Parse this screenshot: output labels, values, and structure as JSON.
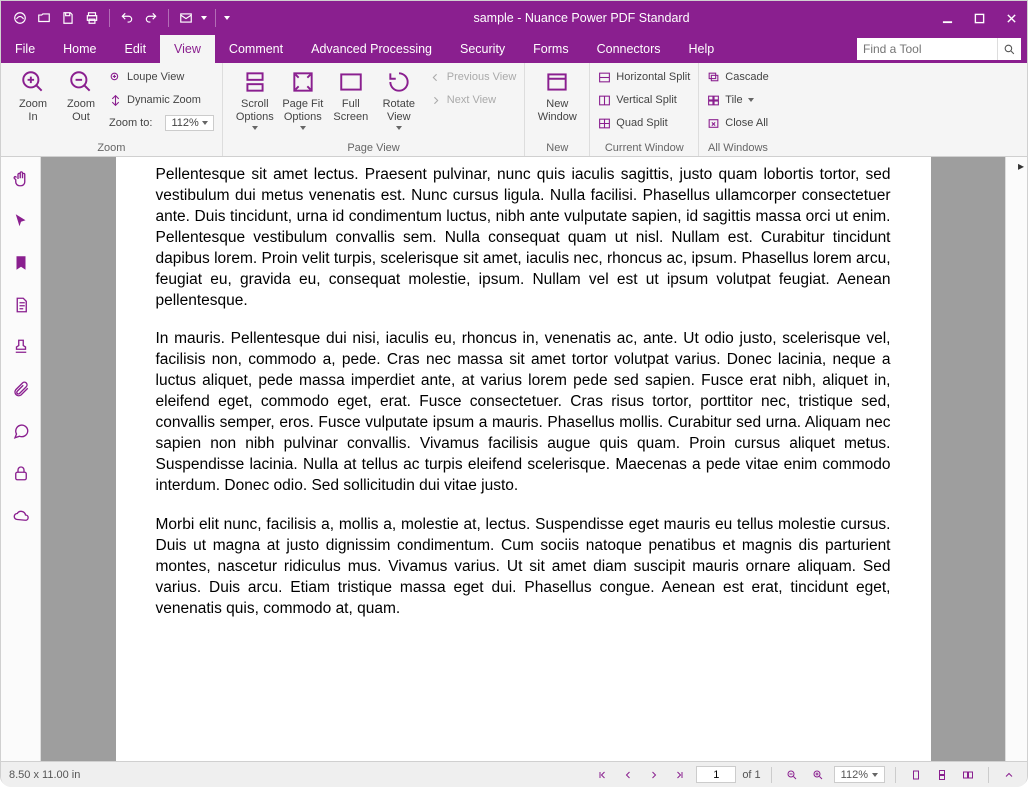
{
  "title": "sample - Nuance Power PDF Standard",
  "menus": [
    "File",
    "Home",
    "Edit",
    "View",
    "Comment",
    "Advanced Processing",
    "Security",
    "Forms",
    "Connectors",
    "Help"
  ],
  "activeMenu": "View",
  "findPlaceholder": "Find a Tool",
  "ribbon": {
    "zoom": {
      "group": "Zoom",
      "in": "Zoom\nIn",
      "out": "Zoom\nOut",
      "loupe": "Loupe View",
      "dynamic": "Dynamic Zoom",
      "zoomto": "Zoom to:",
      "value": "112%"
    },
    "pageview": {
      "group": "Page View",
      "scroll": "Scroll\nOptions",
      "pagefit": "Page Fit\nOptions",
      "full": "Full\nScreen",
      "rotate": "Rotate\nView",
      "prev": "Previous View",
      "next": "Next View"
    },
    "neww": {
      "group": "New",
      "new": "New\nWindow"
    },
    "cur": {
      "group": "Current Window",
      "h": "Horizontal Split",
      "v": "Vertical Split",
      "q": "Quad Split"
    },
    "allw": {
      "group": "All Windows",
      "cascade": "Cascade",
      "tile": "Tile",
      "close": "Close All"
    }
  },
  "doc": {
    "p1": "Pellentesque sit amet lectus. Praesent pulvinar, nunc quis iaculis sagittis, justo quam lobortis tortor, sed vestibulum dui metus venenatis est. Nunc cursus ligula. Nulla facilisi. Phasellus ullamcorper consectetuer ante. Duis tincidunt, urna id condimentum luctus, nibh ante vulputate sapien, id sagittis massa orci ut enim. Pellentesque vestibulum convallis sem. Nulla consequat quam ut nisl. Nullam est. Curabitur tincidunt dapibus lorem. Proin velit turpis, scelerisque sit amet, iaculis nec, rhoncus ac, ipsum. Phasellus lorem arcu, feugiat eu, gravida eu, consequat molestie, ipsum. Nullam vel est ut ipsum volutpat feugiat. Aenean pellentesque.",
    "p2": "In mauris. Pellentesque dui nisi, iaculis eu, rhoncus in, venenatis ac, ante. Ut odio justo, scelerisque vel, facilisis non, commodo a, pede. Cras nec massa sit amet tortor volutpat varius. Donec lacinia, neque a luctus aliquet, pede massa imperdiet ante, at varius lorem pede sed sapien. Fusce erat nibh, aliquet in, eleifend eget, commodo eget, erat. Fusce consectetuer. Cras risus tortor, porttitor nec, tristique sed, convallis semper, eros. Fusce vulputate ipsum a mauris. Phasellus mollis. Curabitur sed urna. Aliquam nec sapien non nibh pulvinar convallis. Vivamus facilisis augue quis quam. Proin cursus aliquet metus. Suspendisse lacinia. Nulla at tellus ac turpis eleifend scelerisque. Maecenas a pede vitae enim commodo interdum. Donec odio. Sed sollicitudin dui vitae justo.",
    "p3": "Morbi elit nunc, facilisis a, mollis a, molestie at, lectus. Suspendisse eget mauris eu tellus molestie cursus. Duis ut magna at justo dignissim condimentum. Cum sociis natoque penatibus et magnis dis parturient montes, nascetur ridiculus mus. Vivamus varius. Ut sit amet diam suscipit mauris ornare aliquam. Sed varius. Duis arcu. Etiam tristique massa eget dui. Phasellus congue. Aenean est erat, tincidunt eget, venenatis quis, commodo at, quam."
  },
  "status": {
    "dims": "8.50 x 11.00 in",
    "page": "1",
    "of": "of 1",
    "zoom": "112%"
  }
}
